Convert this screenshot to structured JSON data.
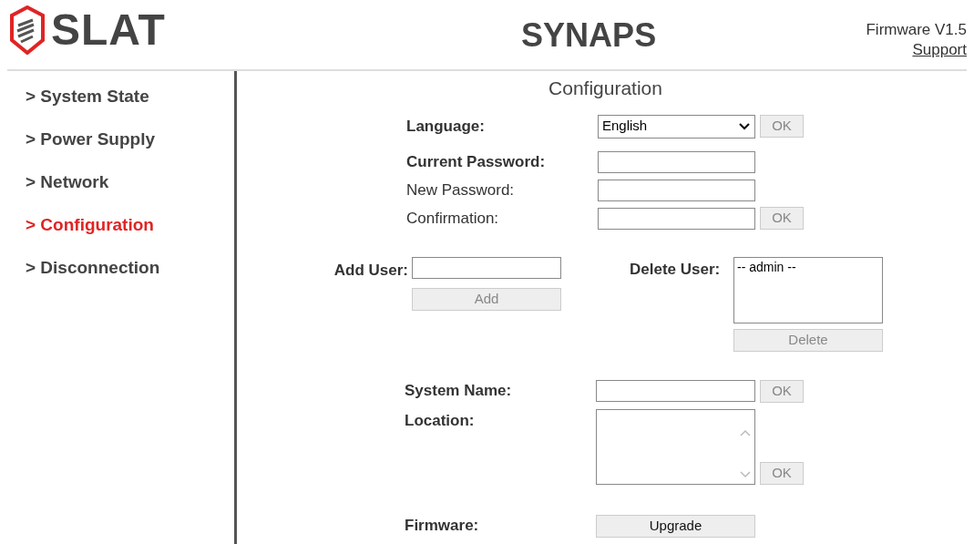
{
  "header": {
    "logo_text": "SLAT",
    "title": "SYNAPS",
    "firmware": "Firmware V1.5",
    "support_link": "Support"
  },
  "sidebar": {
    "items": [
      {
        "label": "> System State",
        "selected": false
      },
      {
        "label": "> Power Supply",
        "selected": false
      },
      {
        "label": "> Network",
        "selected": false
      },
      {
        "label": "> Configuration",
        "selected": true
      },
      {
        "label": "> Disconnection",
        "selected": false
      }
    ]
  },
  "page_title": "Configuration",
  "language": {
    "label": "Language:",
    "value": "English",
    "button": {
      "label": "OK",
      "disabled": true
    }
  },
  "password_fields": [
    {
      "label": "Current Password:",
      "required": true
    },
    {
      "label": "New Password:",
      "required": false
    },
    {
      "label": "Confirmation:",
      "required": false
    }
  ],
  "password_button": {
    "label": "OK",
    "disabled": true
  },
  "add_user": {
    "label": "Add User:",
    "button": {
      "label": "Add",
      "disabled": true
    }
  },
  "delete_user": {
    "label": "Delete User:",
    "users": [
      "-- admin --"
    ],
    "button": {
      "label": "Delete",
      "disabled": true
    }
  },
  "system_name": {
    "label": "System Name:",
    "button": {
      "label": "OK",
      "disabled": true
    }
  },
  "location": {
    "label": "Location:",
    "button": {
      "label": "OK",
      "disabled": true
    }
  },
  "firmware": {
    "label": "Firmware:",
    "button": {
      "label": "Upgrade",
      "disabled": false
    }
  }
}
